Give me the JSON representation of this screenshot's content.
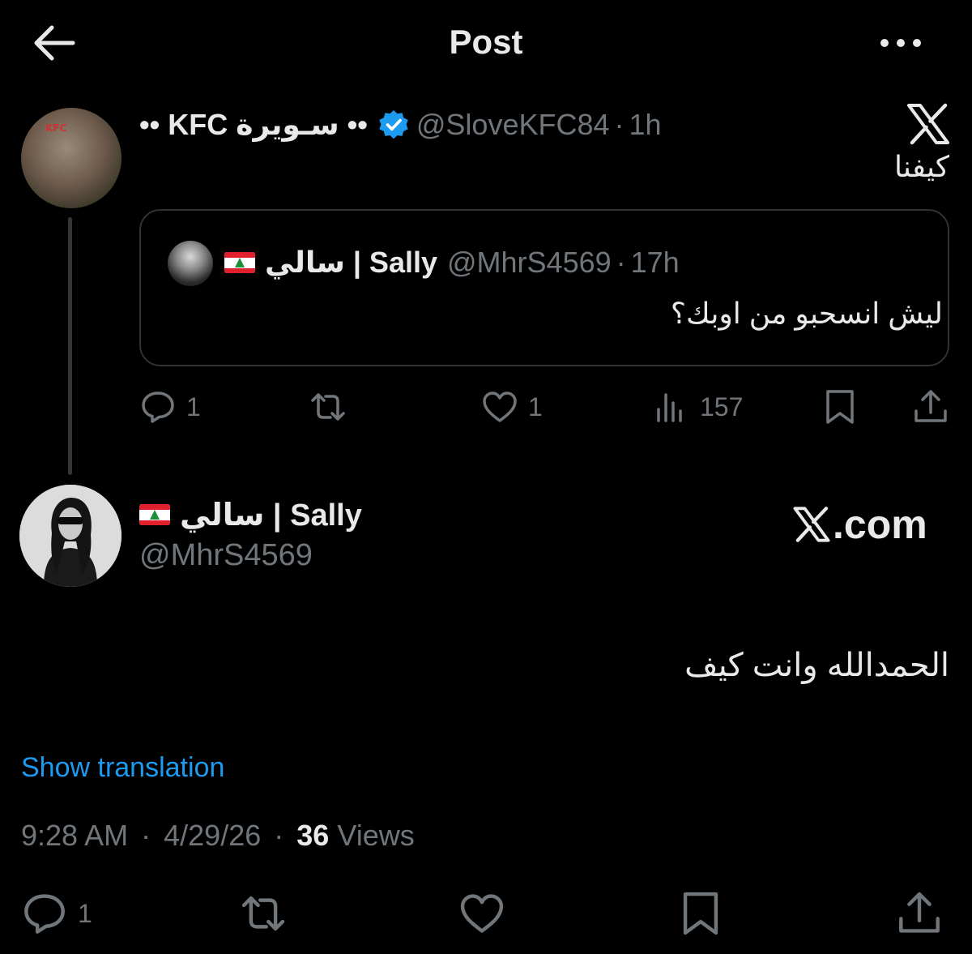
{
  "header": {
    "title": "Post"
  },
  "parent_post": {
    "display_name": "•• سـويرة KFC ••",
    "handle": "@SloveKFC84",
    "time": "1h",
    "avatar_label": "KFC",
    "text": "كيفنا",
    "quoted": {
      "display_name": "سالي | Sally",
      "handle": "@MhrS4569",
      "time": "17h",
      "text": "ليش انسحبو من اوبك؟"
    },
    "actions": {
      "replies": "1",
      "likes": "1",
      "views": "157"
    }
  },
  "main_post": {
    "display_name": "سالي | Sally",
    "handle": "@MhrS4569",
    "text": "الحمدالله وانت كيف",
    "show_translation": "Show translation",
    "time": "9:28 AM",
    "date": "4/29/26",
    "views_count": "36",
    "views_label": "Views",
    "replies": "1"
  },
  "watermark": {
    "label": ".com"
  },
  "colors": {
    "background": "#000000",
    "text": "#e7e9ea",
    "muted": "#71767b",
    "link": "#1d9bf0",
    "verified": "#1d9bf0"
  }
}
